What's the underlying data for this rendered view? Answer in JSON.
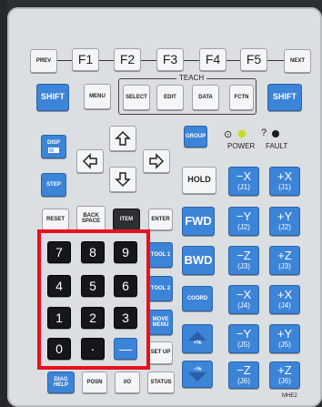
{
  "function_row": {
    "prev": "PREV",
    "f1": "F1",
    "f2": "F2",
    "f3": "F3",
    "f4": "F4",
    "f5": "F5",
    "next": "NEXT"
  },
  "teach_group": {
    "title": "TEACH",
    "select": "SELECT",
    "edit": "EDIT",
    "data": "DATA"
  },
  "top_row": {
    "shift_left": "SHIFT",
    "menu": "MENU",
    "fctn": "FCTN",
    "shift_right": "SHIFT"
  },
  "left_keys": {
    "disp": "DISP",
    "step": "STEP"
  },
  "status": {
    "group": "GROUP",
    "power": "POWER",
    "fault": "FAULT",
    "power_symbol": "⊙",
    "fault_symbol": "?"
  },
  "center_keys": {
    "hold": "HOLD",
    "fwd": "FWD",
    "bwd": "BWD",
    "coord": "COORD"
  },
  "edit_row": {
    "reset": "RESET",
    "backspace": "BACK SPACE",
    "item": "ITEM",
    "enter": "ENTER"
  },
  "tool_keys": {
    "tool1": "TOOL 1",
    "tool2": "TOOL 2",
    "move_menu": "MOVE MENU",
    "set_up": "SET UP"
  },
  "numpad": {
    "k7": "7",
    "k8": "8",
    "k9": "9",
    "k4": "4",
    "k5": "5",
    "k6": "6",
    "k1": "1",
    "k2": "2",
    "k3": "3",
    "k0": "0",
    "dot": "·",
    "minus": "—"
  },
  "bottom_row": {
    "diag_help": "DIAG HELP",
    "posn": "POSN",
    "io": "I/O",
    "status": "STATUS"
  },
  "jog_keys": {
    "neg_x": "−X",
    "neg_x_sub": "(J1)",
    "pos_x": "+X",
    "pos_x_sub": "(J1)",
    "neg_y": "−Y",
    "neg_y_sub": "(J2)",
    "pos_y": "+Y",
    "pos_y_sub": "(J2)",
    "neg_z": "−Z",
    "neg_z_sub": "(J3)",
    "pos_z": "+Z",
    "pos_z_sub": "(J3)",
    "neg_rx": "−X",
    "neg_rx_sub": "(J4)",
    "pos_rx": "+X",
    "pos_rx_sub": "(J4)",
    "neg_ry": "−Y",
    "neg_ry_sub": "(J5)",
    "pos_ry": "+Y",
    "pos_ry_sub": "(J5)",
    "neg_rz": "−Z",
    "neg_rz_sub": "(J6)",
    "pos_rz": "+Z",
    "pos_rz_sub": "(J6)"
  },
  "speed": {
    "plus": "+%",
    "minus": "−%"
  },
  "model": "MHE2"
}
